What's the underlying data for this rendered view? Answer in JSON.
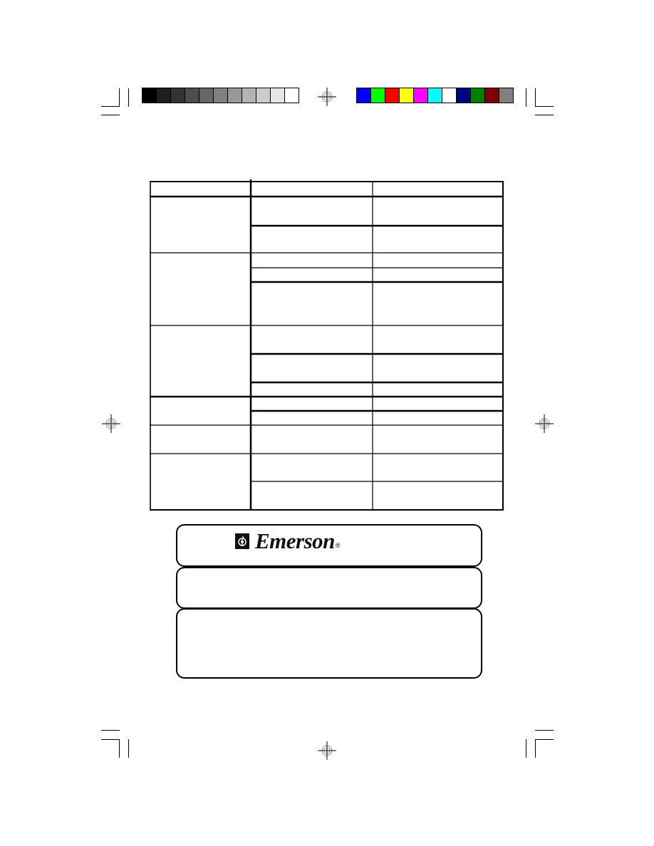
{
  "page": {
    "type": "printed-manual-page",
    "calibration_bars": {
      "grayscale": [
        "#000000",
        "#1e1e1e",
        "#333333",
        "#4d4d4d",
        "#666666",
        "#808080",
        "#999999",
        "#b3b3b3",
        "#cccccc",
        "#e6e6e6",
        "#ffffff"
      ],
      "color": [
        "#0000ff",
        "#00ff00",
        "#ff0000",
        "#ffff00",
        "#ff00ff",
        "#00ffff",
        "#ffffff",
        "#000080",
        "#008000",
        "#800000",
        "#808080"
      ]
    },
    "table": {
      "columns": [
        "",
        "",
        ""
      ],
      "groups": [
        {
          "label": "",
          "rows": [
            [
              "",
              ""
            ],
            [
              "",
              ""
            ]
          ]
        },
        {
          "label": "",
          "rows": [
            [
              "",
              ""
            ],
            [
              "",
              ""
            ],
            [
              "",
              ""
            ]
          ]
        },
        {
          "label": "",
          "rows": [
            [
              "",
              ""
            ],
            [
              "",
              ""
            ],
            [
              "",
              ""
            ]
          ]
        },
        {
          "label": "",
          "rows": [
            [
              "",
              ""
            ],
            [
              "",
              ""
            ]
          ]
        },
        {
          "label": "",
          "rows": [
            [
              "",
              ""
            ]
          ]
        },
        {
          "label": "",
          "rows": [
            [
              "",
              ""
            ],
            [
              "",
              ""
            ]
          ]
        }
      ]
    },
    "brand": {
      "name": "Emerson",
      "registered_mark": "®",
      "logo_icon": "emerson-g-clef-icon"
    },
    "boxes": [
      {
        "text": ""
      },
      {
        "text": ""
      },
      {
        "text": ""
      }
    ]
  }
}
